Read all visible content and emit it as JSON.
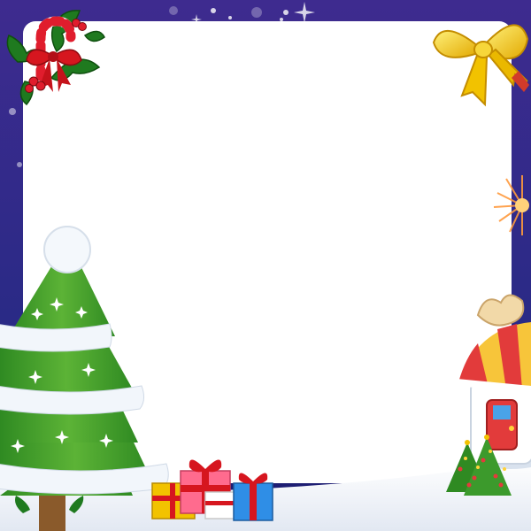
{
  "frame": {
    "type": "christmas-photo-frame",
    "center": "blank",
    "colors": {
      "background": "#3b2b8c",
      "background_deep": "#1a1a6e",
      "photo_area": "#ffffff",
      "snow": "#eef2f8",
      "tree_green": "#3c9a2c",
      "tree_green_light": "#7ccb44",
      "bow_gold": "#f2c200",
      "house_red": "#e23b3b",
      "house_yellow": "#f7c53a",
      "firework_orange": "#ff9a3c"
    },
    "decorations": [
      {
        "name": "holly-candy-cane-icon",
        "corner": "top-left"
      },
      {
        "name": "gold-bow-icon",
        "corner": "top-right"
      },
      {
        "name": "christmas-tree-icon",
        "corner": "bottom-left"
      },
      {
        "name": "gift-boxes-icon",
        "corner": "bottom-center"
      },
      {
        "name": "candy-house-icon",
        "corner": "bottom-right"
      },
      {
        "name": "firework-icon",
        "corner": "right"
      }
    ]
  }
}
